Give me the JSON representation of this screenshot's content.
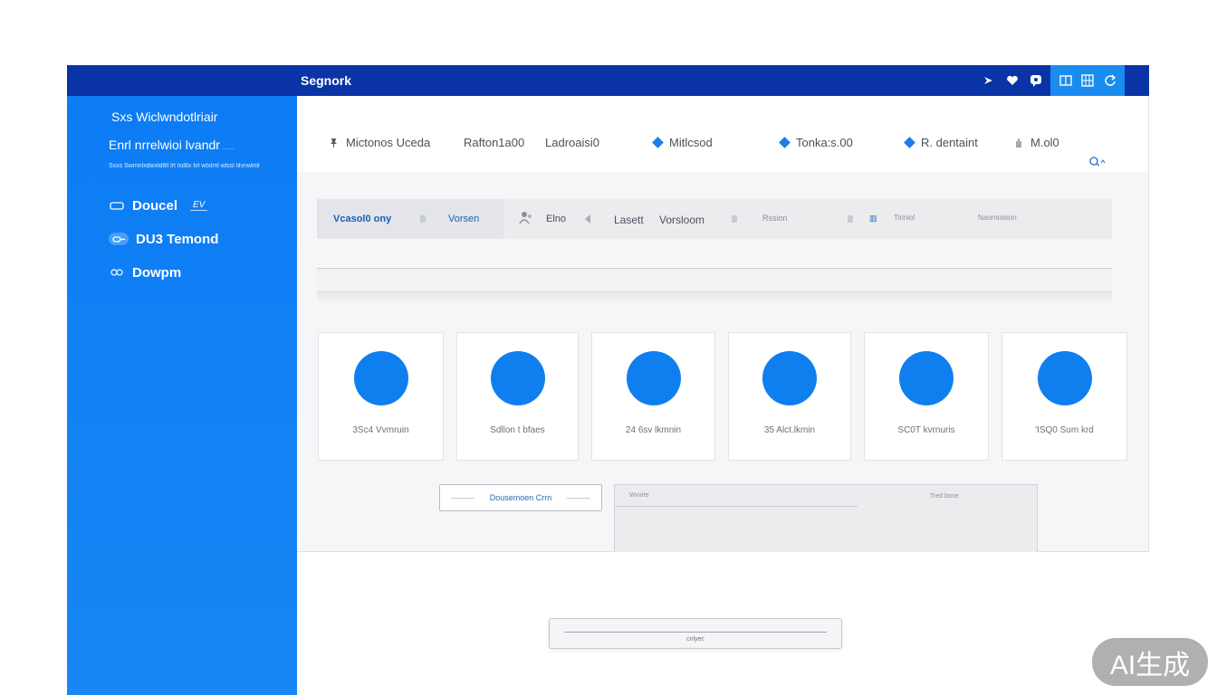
{
  "window": {
    "title": "Segnork"
  },
  "sidebar": {
    "heading": "Sxs Wiclwndotlriair",
    "subheading": "Enrl nrrelwioi lvandr",
    "subheading_small": "........",
    "description": "Sxxs Swmnlxdwxldltll lrt lxdllx lvt wtxlml wlssl lilvnwlnlr",
    "items": [
      {
        "label": "Doucel",
        "badge": "EV",
        "icon": "folder-icon"
      },
      {
        "label": "DU3 Temond",
        "badge": "",
        "icon": "link-icon",
        "selected": true
      },
      {
        "label": "Dowpm",
        "badge": "",
        "icon": "download-icon"
      }
    ]
  },
  "toolbar": {
    "items": [
      {
        "label": "Mictonos Uceda",
        "icon": "pin-icon"
      },
      {
        "label": "Rafton1a00",
        "icon": ""
      },
      {
        "label": "Ladroaisi0",
        "icon": ""
      },
      {
        "label": "Mitlcsod",
        "icon": "diamond-icon"
      },
      {
        "label": "Tonka:s.00",
        "icon": "diamond-icon"
      },
      {
        "label": "R. dentaint",
        "icon": "diamond-icon"
      },
      {
        "label": "M.ol0",
        "icon": "hand-icon"
      }
    ],
    "search_label": "Q"
  },
  "tabs": [
    {
      "label": "Vcasol0 ony"
    },
    {
      "label": "Vorsen"
    },
    {
      "label": "Elno"
    },
    {
      "label": "Lasett"
    },
    {
      "label": "Vorsloom"
    },
    {
      "label": "Rssion"
    },
    {
      "label": "Tiriniol"
    },
    {
      "label": "Naornoision"
    }
  ],
  "cards": [
    {
      "label": "3Sc4 Vvmruin"
    },
    {
      "label": "Sdllon t bfaes"
    },
    {
      "label": "24 6sv lkmnin"
    },
    {
      "label": "35 Alct.lkmin"
    },
    {
      "label": "SC0T kvrnuris"
    },
    {
      "label": "'ISQ0 Sum krd"
    }
  ],
  "actions": {
    "outline_button": "Dousemoen Crrn",
    "filter_placeholder": "Wvxrte",
    "filter_right": "Tred bone"
  },
  "floating_bar": {
    "label": "cnlyec"
  },
  "watermark": "AI生成",
  "colors": {
    "titlebar": "#0a33a6",
    "accent": "#0f7ff0",
    "sidebar": "#0c7cf5",
    "panel": "#f6f6f8"
  }
}
